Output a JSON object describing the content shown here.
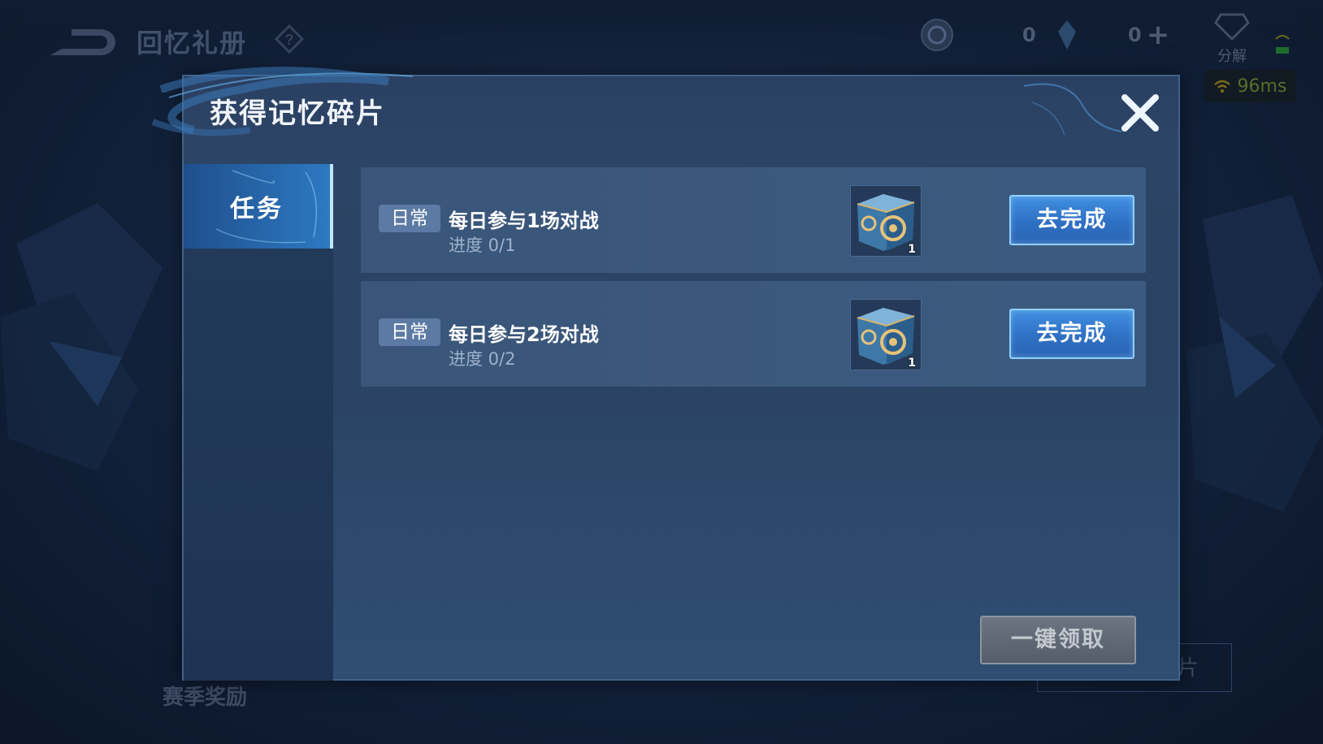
{
  "background": {
    "title": "回忆礼册",
    "currencies": [
      {
        "icon": "coin-icon",
        "value": "0"
      },
      {
        "icon": "crystal-icon",
        "value": "0"
      }
    ],
    "decompose_label": "分解",
    "ping": "96ms",
    "bottom_label": "赛季奖励",
    "bottom_button_partial": "片"
  },
  "dialog": {
    "title": "获得记忆碎片",
    "tabs": [
      {
        "label": "任务",
        "active": true
      }
    ],
    "tasks": [
      {
        "tag": "日常",
        "name": "每日参与1场对战",
        "progress": "进度 0/1",
        "reward_count": "1",
        "button": "去完成"
      },
      {
        "tag": "日常",
        "name": "每日参与2场对战",
        "progress": "进度 0/2",
        "reward_count": "1",
        "button": "去完成"
      }
    ],
    "claim_all": "一键领取"
  },
  "colors": {
    "accent_blue": "#2f70c4",
    "tag_bg": "#5c7aa3",
    "disabled_button": "#616976"
  }
}
